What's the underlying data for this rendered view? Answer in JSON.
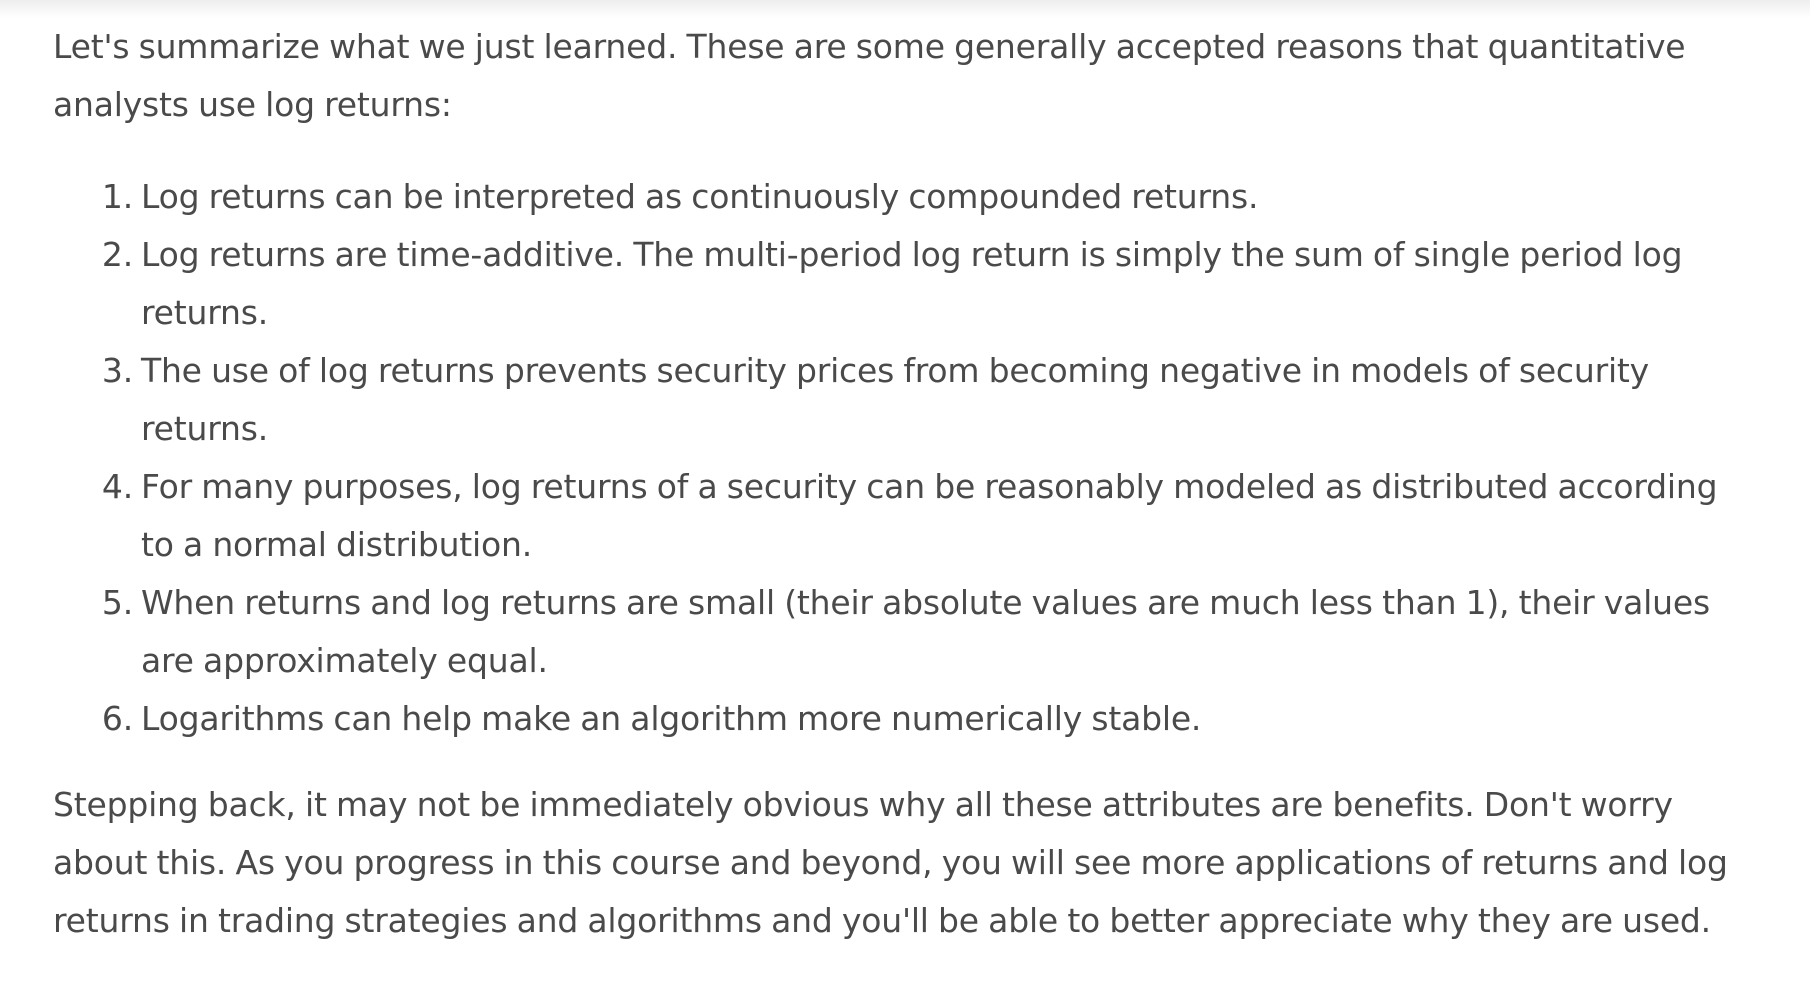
{
  "intro": "Let's summarize what we just learned. These are some generally accepted reasons that quantitative analysts use log returns:",
  "reasons": [
    {
      "number": "1.",
      "text": "Log returns can be interpreted as continuously compounded returns."
    },
    {
      "number": "2.",
      "text": "Log returns are time-additive. The multi-period log return is simply the sum of single period log returns."
    },
    {
      "number": "3.",
      "text": "The use of log returns prevents security prices from becoming negative in models of security returns."
    },
    {
      "number": "4.",
      "text": "For many purposes, log returns of a security can be reasonably modeled as distributed according to a normal distribution."
    },
    {
      "number": "5.",
      "text": "When returns and log returns are small (their absolute values are much less than 1), their values are approximately equal."
    },
    {
      "number": "6.",
      "text": "Logarithms can help make an algorithm more numerically stable."
    }
  ],
  "closing": "Stepping back, it may not be immediately obvious why all these attributes are benefits. Don't worry about this. As you progress in this course and beyond, you will see more applications of returns and log returns in trading strategies and algorithms and you'll be able to better appreciate why they are used."
}
